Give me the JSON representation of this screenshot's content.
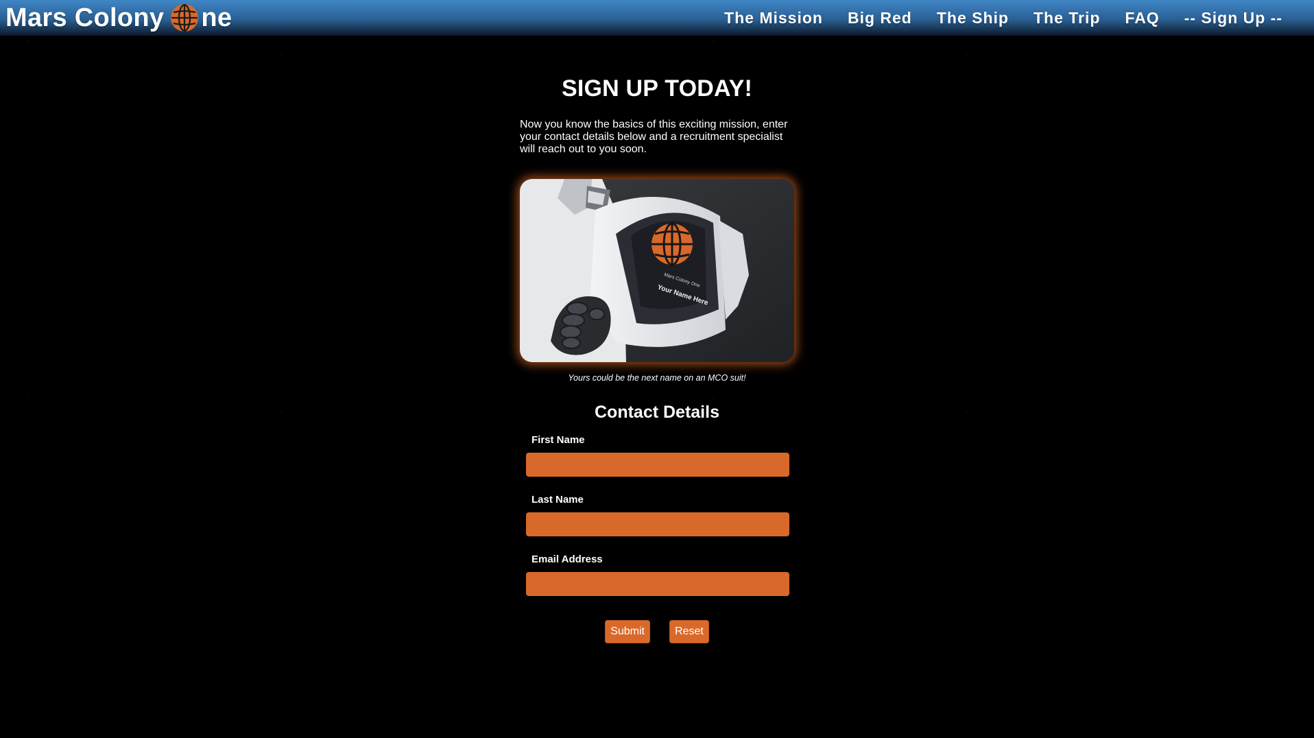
{
  "header": {
    "brand": {
      "text_before": "Mars Colony ",
      "logo_icon": "globe-icon",
      "text_after": "ne"
    },
    "nav": [
      {
        "label": "The Mission",
        "name": "nav-item-the-mission"
      },
      {
        "label": "Big Red",
        "name": "nav-item-big-red"
      },
      {
        "label": "The Ship",
        "name": "nav-item-the-ship"
      },
      {
        "label": "The Trip",
        "name": "nav-item-the-trip"
      },
      {
        "label": "FAQ",
        "name": "nav-item-faq"
      },
      {
        "label": "-- Sign Up --",
        "name": "nav-item-sign-up"
      }
    ]
  },
  "main": {
    "title": "SIGN UP TODAY!",
    "intro": "Now you know the basics of this exciting mission, enter your contact details below and a recruitment specialist will reach out to you soon.",
    "hero": {
      "patch_line1": "Mars Colony One",
      "patch_line2": "Your Name Here"
    },
    "caption": "Yours could be the next name on an MCO suit!"
  },
  "form": {
    "title": "Contact Details",
    "fields": [
      {
        "label": "First Name",
        "value": "",
        "placeholder": ""
      },
      {
        "label": "Last Name",
        "value": "",
        "placeholder": ""
      },
      {
        "label": "Email Address",
        "value": "",
        "placeholder": ""
      }
    ],
    "submit_label": "Submit",
    "reset_label": "Reset"
  },
  "colors": {
    "accent": "#d9692a",
    "header_top": "#3f86c6",
    "background": "#000000"
  }
}
